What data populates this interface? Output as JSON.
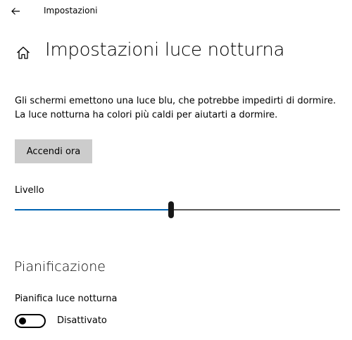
{
  "window": {
    "title": "Impostazioni"
  },
  "header": {
    "title": "Impostazioni luce notturna",
    "icon": "home-icon"
  },
  "description": {
    "line1": "Gli schermi emettono una luce blu, che potrebbe impedirti di dormire.",
    "line2": "La luce notturna ha colori più caldi per aiutarti a dormire."
  },
  "actions": {
    "turn_on_label": "Accendi ora"
  },
  "level": {
    "label": "Livello",
    "value_fraction": 0.48
  },
  "schedule": {
    "heading": "Pianificazione",
    "label": "Pianifica luce notturna",
    "toggle_state": "Disattivato",
    "toggle_on": false
  },
  "colors": {
    "accent": "#0063b1",
    "button_bg": "#cccccc",
    "track_inactive": "#5c5c5c"
  }
}
